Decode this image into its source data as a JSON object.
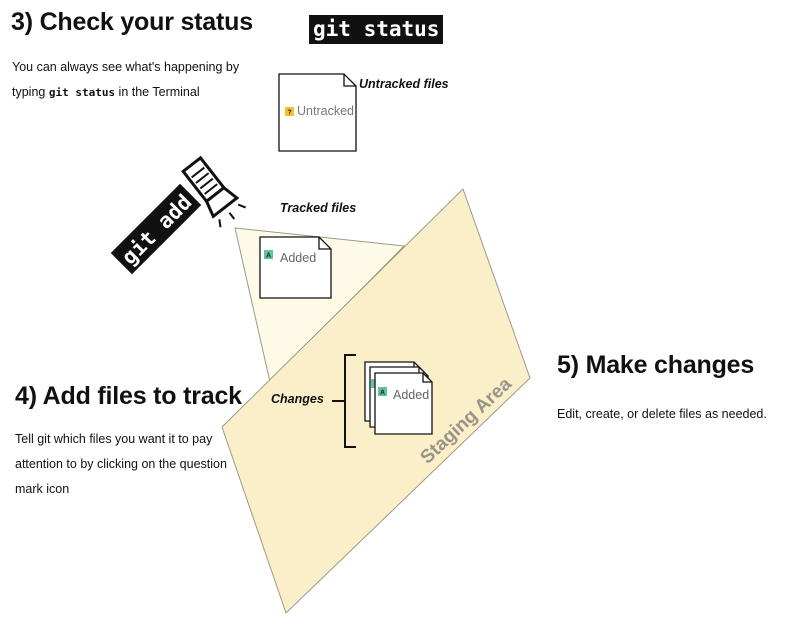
{
  "section3": {
    "heading": "3) Check your status",
    "line1": "You can always see what's happening by",
    "line2_before": "typing ",
    "line2_code": "git status",
    "line2_after": " in the Terminal",
    "command": "git status"
  },
  "section4": {
    "heading": "4) Add files to track",
    "line1": "Tell git which files you want it to pay",
    "line2": "attention to by clicking on the question",
    "line3": "mark icon"
  },
  "section5": {
    "heading": "5) Make changes",
    "line1": "Edit, create, or delete files as needed."
  },
  "diagram": {
    "untracked_label": "Untracked files",
    "untracked_file": {
      "badge": "?",
      "name": "Untracked",
      "badge_color": "#f2c12e"
    },
    "tracked_label": "Tracked files",
    "tracked_file": {
      "badge": "A",
      "name": "Added",
      "badge_color": "#5fc49a"
    },
    "git_add_command": "git add",
    "changes_label": "Changes",
    "changes_file": {
      "badge": "A",
      "name": "Added",
      "badge_color": "#5fc49a"
    },
    "staging_area_label": "Staging Area"
  },
  "colors": {
    "staging_fill": "#fbefc9",
    "beam_fill": "#fdfbe8",
    "outline": "#9a9a88"
  }
}
